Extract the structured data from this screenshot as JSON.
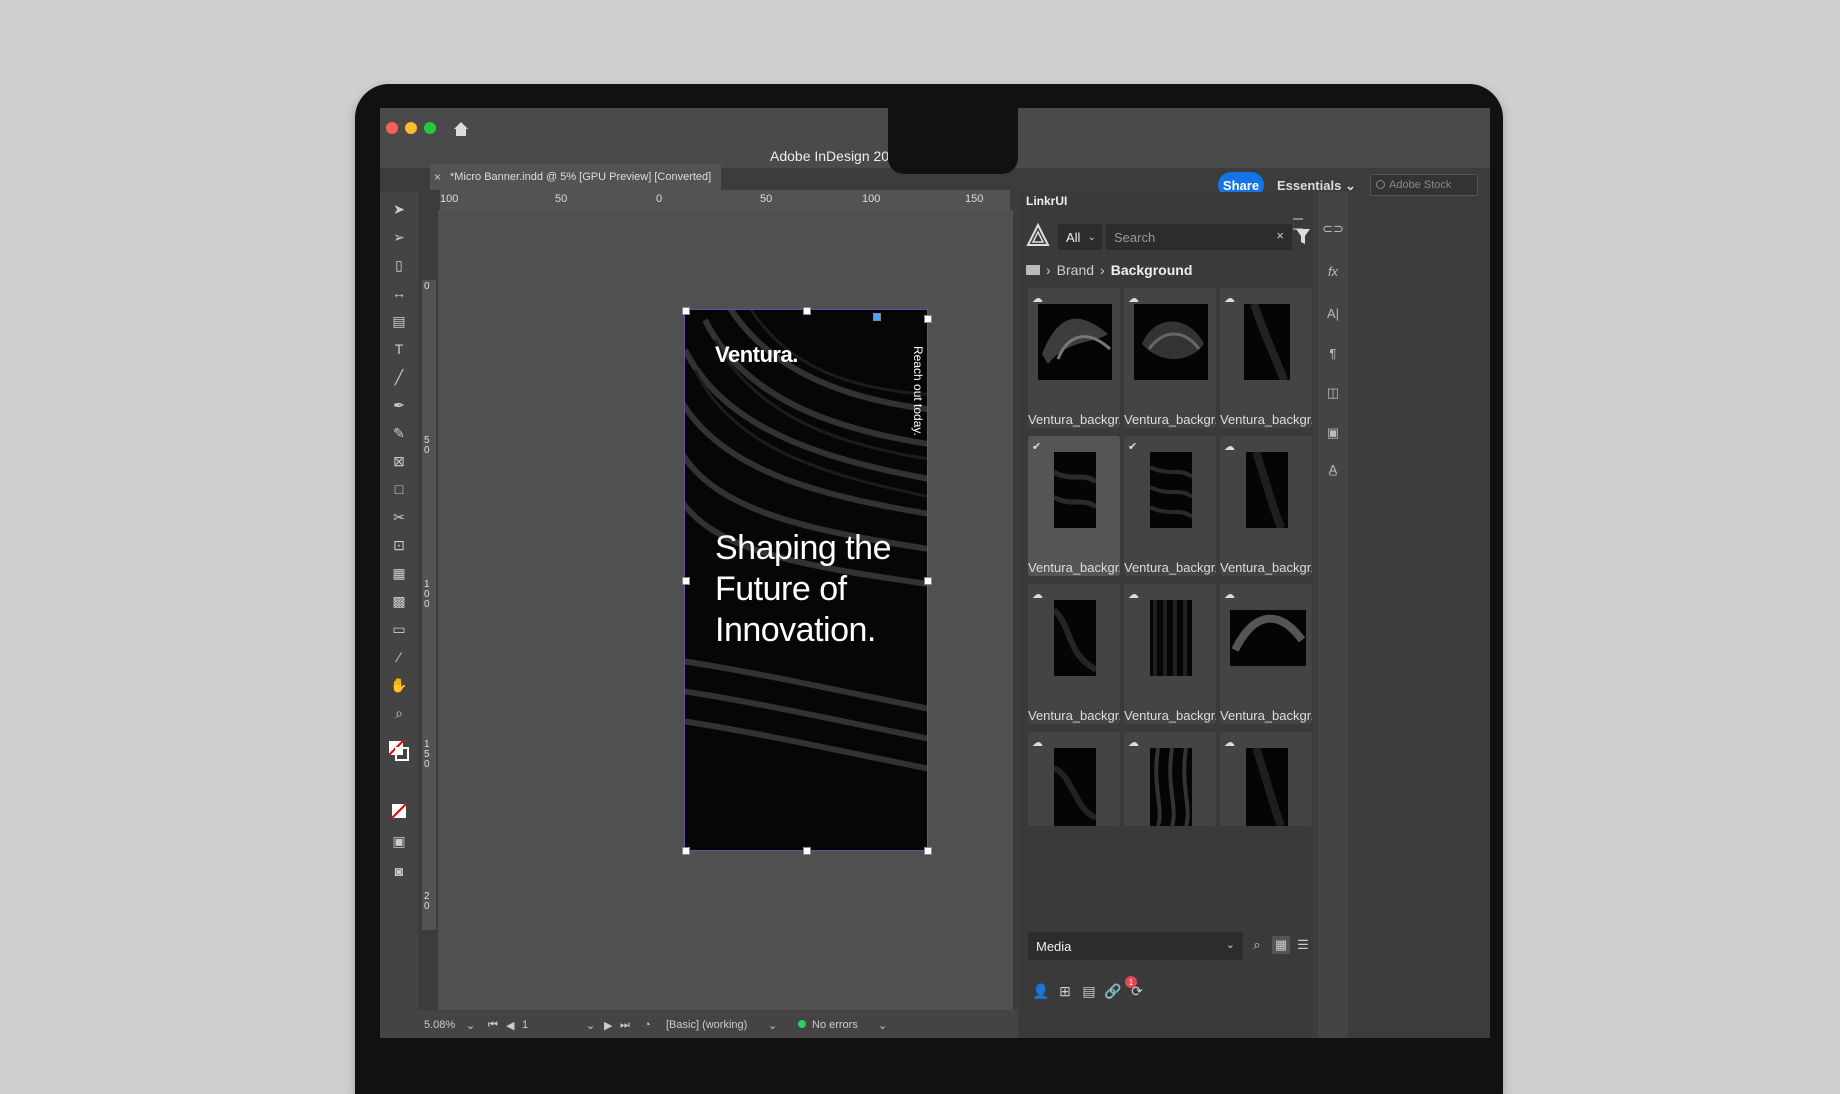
{
  "window": {
    "title": "Adobe InDesign 2025",
    "share_label": "Share",
    "workspace_label": "Essentials",
    "stock_placeholder": "Adobe Stock"
  },
  "document": {
    "tab_label": "*Micro Banner.indd @ 5% [GPU Preview] [Converted]",
    "close_glyph": "×"
  },
  "ruler": {
    "horizontal_ticks": [
      "100",
      "50",
      "0",
      "50",
      "100",
      "150"
    ],
    "vertical_ticks": [
      "0",
      "5 0",
      "1 0 0",
      "1 5 0",
      "2 0"
    ]
  },
  "artboard": {
    "brand": "Ventura.",
    "cta": "Reach out today.",
    "headline": "Shaping the Future of Innovation."
  },
  "panel": {
    "title": "LinkrUI",
    "filter_value": "All",
    "search_placeholder": "Search",
    "clear_glyph": "×",
    "breadcrumb": [
      "Brand",
      "Background"
    ],
    "assets": [
      {
        "name": "Ventura_backgr...",
        "badge": "cloud"
      },
      {
        "name": "Ventura_backgr...",
        "badge": "cloud"
      },
      {
        "name": "Ventura_backgr...",
        "badge": "cloud"
      },
      {
        "name": "Ventura_backgr...",
        "badge": "check"
      },
      {
        "name": "Ventura_backgr...",
        "badge": "check"
      },
      {
        "name": "Ventura_backgr...",
        "badge": "cloud"
      },
      {
        "name": "Ventura_backgr...",
        "badge": "cloud"
      },
      {
        "name": "Ventura_backgr...",
        "badge": "cloud"
      },
      {
        "name": "Ventura_backgr...",
        "badge": "cloud"
      },
      {
        "name": "",
        "badge": "cloud"
      },
      {
        "name": "",
        "badge": "cloud"
      },
      {
        "name": "",
        "badge": "cloud"
      }
    ],
    "media_value": "Media",
    "notification_count": "1"
  },
  "status": {
    "zoom": "5.08%",
    "page": "1",
    "style": "[Basic] (working)",
    "preflight": "No errors"
  },
  "colors": {
    "accent": "#1473e6",
    "frame": "#6c4aa8",
    "ok": "#2ecc71"
  }
}
